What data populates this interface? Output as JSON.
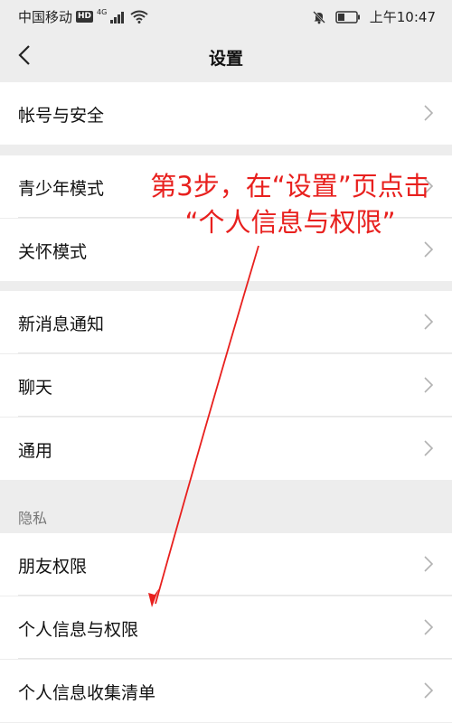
{
  "status_bar": {
    "carrier": "中国移动",
    "hd": "HD",
    "network": "4G",
    "time": "上午10:47"
  },
  "nav": {
    "title": "设置"
  },
  "sections": [
    {
      "items": [
        {
          "label": "帐号与安全"
        }
      ]
    },
    {
      "items": [
        {
          "label": "青少年模式"
        },
        {
          "label": "关怀模式"
        }
      ]
    },
    {
      "items": [
        {
          "label": "新消息通知"
        },
        {
          "label": "聊天"
        },
        {
          "label": "通用"
        }
      ]
    },
    {
      "header": "隐私",
      "items": [
        {
          "label": "朋友权限"
        },
        {
          "label": "个人信息与权限"
        },
        {
          "label": "个人信息收集清单"
        }
      ]
    }
  ],
  "annotation": {
    "line1": "第3步，在“设置”页点击",
    "line2": "“个人信息与权限”",
    "color": "#e8201e"
  },
  "icons": [
    "back-arrow-icon",
    "wifi-icon",
    "signal-icon",
    "bell-off-icon",
    "battery-icon",
    "chevron-right-icon"
  ]
}
